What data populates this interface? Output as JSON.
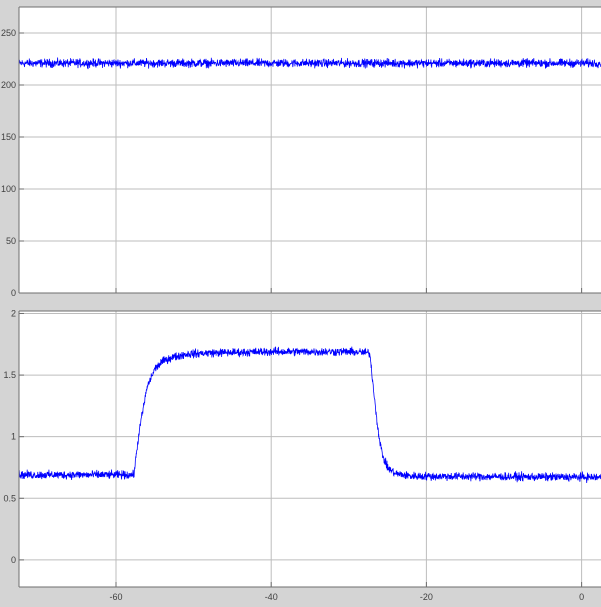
{
  "colors": {
    "figure_background": "#d4d4d4",
    "axes_background": "#ffffff",
    "grid": "#bdbdbd",
    "axis_line": "#6e6e6e",
    "tick_text": "#404040",
    "signal": "#0000ff"
  },
  "chart_data": [
    {
      "type": "line",
      "title": "",
      "xlabel": "",
      "ylabel": "",
      "grid": true,
      "xlim": [
        -72.5,
        2.5
      ],
      "ylim": [
        0,
        275
      ],
      "xticks": [
        -60,
        -40,
        -20,
        0
      ],
      "xtick_labels_visible": false,
      "yticks": [
        0,
        50,
        100,
        150,
        200,
        250
      ],
      "ytick_labels": [
        "0",
        "50",
        "100",
        "150",
        "200",
        "250"
      ],
      "series": [
        {
          "color": "#0000ff",
          "noisy": true,
          "noise_amplitude": 6,
          "x": [
            -72.5,
            2.5
          ],
          "y": [
            221,
            221
          ]
        }
      ]
    },
    {
      "type": "line",
      "title": "",
      "xlabel": "",
      "ylabel": "",
      "grid": true,
      "xlim": [
        -72.5,
        2.5
      ],
      "ylim": [
        -0.22,
        2.02
      ],
      "xticks": [
        -60,
        -40,
        -20,
        0
      ],
      "xtick_labels_visible": true,
      "xtick_labels": [
        "-60",
        "-40",
        "-20",
        "0"
      ],
      "yticks": [
        0,
        0.5,
        1,
        1.5,
        2
      ],
      "ytick_labels": [
        "0",
        "0.5",
        "1",
        "1.5",
        "2"
      ],
      "series": [
        {
          "color": "#0000ff",
          "noisy": true,
          "noise_amplitude": 0.05,
          "x": [
            -72.5,
            -57.7,
            -57.0,
            -56.0,
            -55.0,
            -54.0,
            -53.0,
            -51.0,
            -48.0,
            -40.0,
            -30.0,
            -27.3,
            -27.0,
            -26.5,
            -26.0,
            -25.5,
            -25.0,
            -24.0,
            -22.0,
            2.5
          ],
          "y": [
            0.69,
            0.69,
            1.05,
            1.4,
            1.55,
            1.61,
            1.64,
            1.67,
            1.68,
            1.69,
            1.69,
            1.68,
            1.5,
            1.2,
            0.95,
            0.82,
            0.75,
            0.7,
            0.68,
            0.67
          ]
        }
      ]
    }
  ]
}
